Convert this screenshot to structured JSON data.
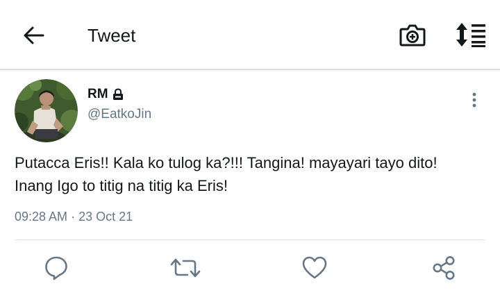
{
  "header": {
    "title": "Tweet",
    "back_icon": "back-arrow-icon",
    "camera_icon": "camera-add-icon",
    "sort_icon": "sort-list-icon"
  },
  "tweet": {
    "display_name": "RM",
    "protected_icon": "lock-icon",
    "handle": "@EatkoJin",
    "text": "Putacca Eris!! Kala ko tulog ka?!!! Tangina! mayayari tayo dito! Inang Igo to titig na titig ka Eris!",
    "time": "09:28 AM",
    "separator": "·",
    "date": "23 Oct 21"
  },
  "actions": [
    "reply-icon",
    "retweet-icon",
    "like-icon",
    "share-icon"
  ],
  "colors": {
    "text": "#14171a",
    "muted": "#657786",
    "icon": "#657786",
    "divider": "#e1e8ed"
  }
}
